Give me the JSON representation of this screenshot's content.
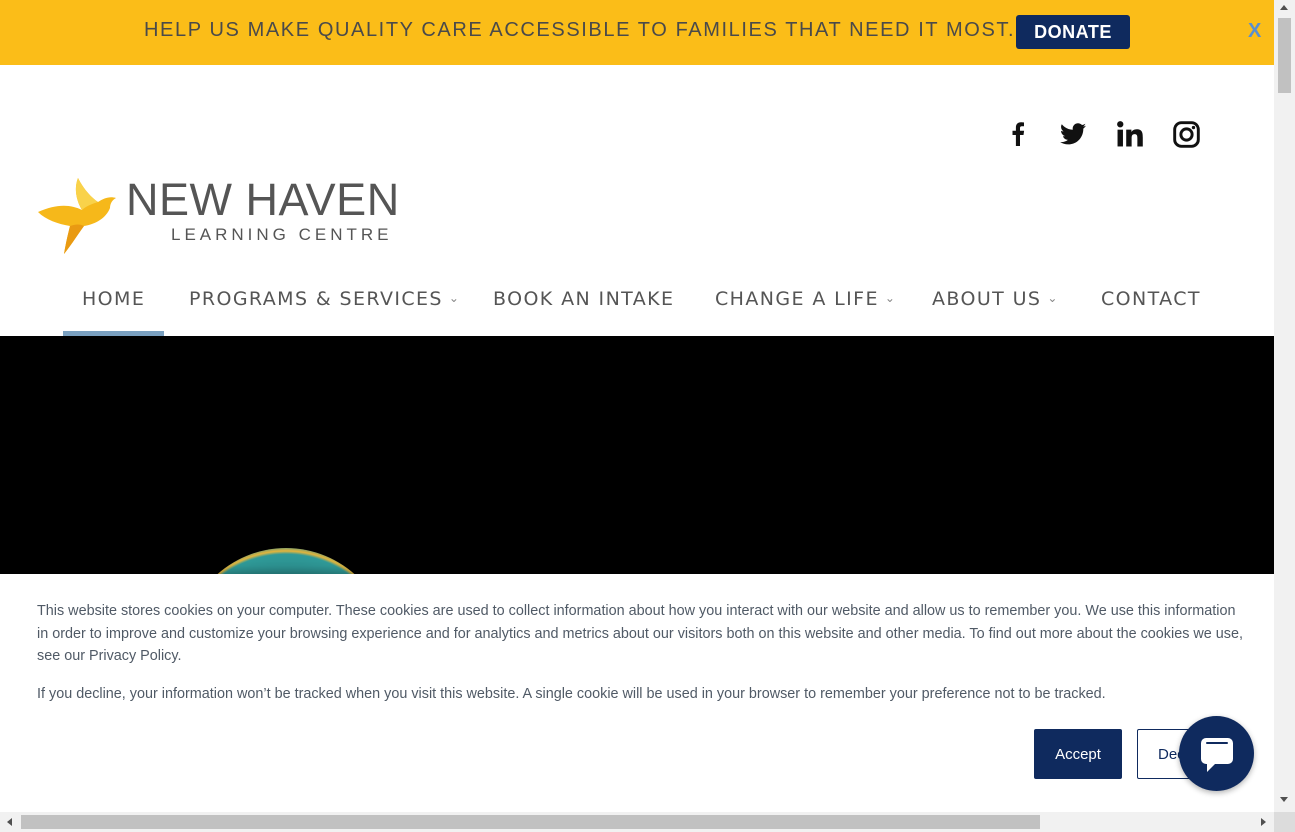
{
  "banner": {
    "text": "HELP US MAKE QUALITY CARE ACCESSIBLE TO FAMILIES THAT NEED IT MOST.",
    "donate_label": "DONATE",
    "close_label": "X",
    "background": "#fbbd18",
    "donate_color": "#0f2a5e"
  },
  "social": {
    "icons": [
      "facebook-icon",
      "twitter-icon",
      "linkedin-icon",
      "instagram-icon"
    ]
  },
  "logo": {
    "name": "NEW HAVEN",
    "subtitle": "LEARNING CENTRE",
    "bird_color": "#f6b81a"
  },
  "nav": {
    "items": [
      {
        "label": "HOME",
        "has_dropdown": false,
        "active": true
      },
      {
        "label": "PROGRAMS & SERVICES",
        "has_dropdown": true
      },
      {
        "label": "BOOK AN INTAKE",
        "has_dropdown": false
      },
      {
        "label": "CHANGE A LIFE",
        "has_dropdown": true
      },
      {
        "label": "ABOUT US",
        "has_dropdown": true
      },
      {
        "label": "CONTACT",
        "has_dropdown": false
      }
    ],
    "chevron": "chevron-down-icon",
    "active_underline_color": "#7aa0c0"
  },
  "hero": {
    "background": "#000000"
  },
  "cookie": {
    "paragraph1": "This website stores cookies on your computer. These cookies are used to collect information about how you interact with our website and allow us to remember you. We use this information in order to improve and customize your browsing experience and for analytics and metrics about our visitors both on this website and other media. To find out more about the cookies we use, see our Privacy Policy.",
    "paragraph2": "If you decline, your information won’t be tracked when you visit this website. A single cookie will be used in your browser to remember your preference not to be tracked.",
    "accept_label": "Accept",
    "decline_label": "Decline"
  },
  "chat": {
    "icon": "chat-icon",
    "color": "#0f2a5e"
  }
}
